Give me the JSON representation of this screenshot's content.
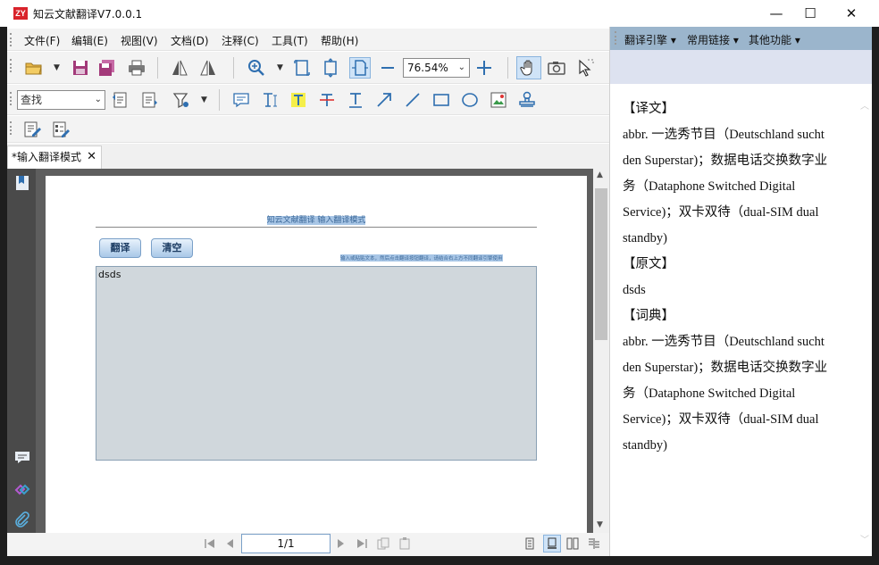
{
  "app": {
    "title": "知云文献翻译V7.0.0.1",
    "logo": "ZY"
  },
  "window_controls": {
    "minimize": "—",
    "maximize": "☐",
    "close": "✕"
  },
  "menu": [
    "文件(F)",
    "编辑(E)",
    "视图(V)",
    "文档(D)",
    "注释(C)",
    "工具(T)",
    "帮助(H)"
  ],
  "toolbar": {
    "zoom_value": "76.54%",
    "search_placeholder": "查找"
  },
  "tab": {
    "label": "*输入翻译模式",
    "close": "✕"
  },
  "document": {
    "title": "知云文献翻译  输入翻译模式",
    "translate_button": "翻译",
    "clear_button": "清空",
    "hint": "输入或粘贴文本，然后点击翻译按钮翻译，请结合右上方不同翻译引擎使用",
    "input_text": "dsds"
  },
  "status": {
    "page": "1/1"
  },
  "right_panel": {
    "menu": [
      "翻译引擎",
      "常用链接",
      "其他功能"
    ],
    "lines": [
      "【译文】",
      "abbr. 一选秀节目（Deutschland sucht",
      "den Superstar)；数据电话交换数字业",
      "务（Dataphone Switched Digital",
      "Service)；双卡双待（dual-SIM dual",
      "standby)",
      "【原文】",
      "dsds",
      "【词典】",
      "abbr. 一选秀节目（Deutschland sucht",
      "den Superstar)；数据电话交换数字业",
      "务（Dataphone Switched Digital",
      "Service)；双卡双待（dual-SIM dual",
      "standby)"
    ]
  },
  "colors": {
    "accent": "#9bb5cc",
    "doc_bg": "#5e5e5e",
    "highlight": "#a8c6e6"
  }
}
